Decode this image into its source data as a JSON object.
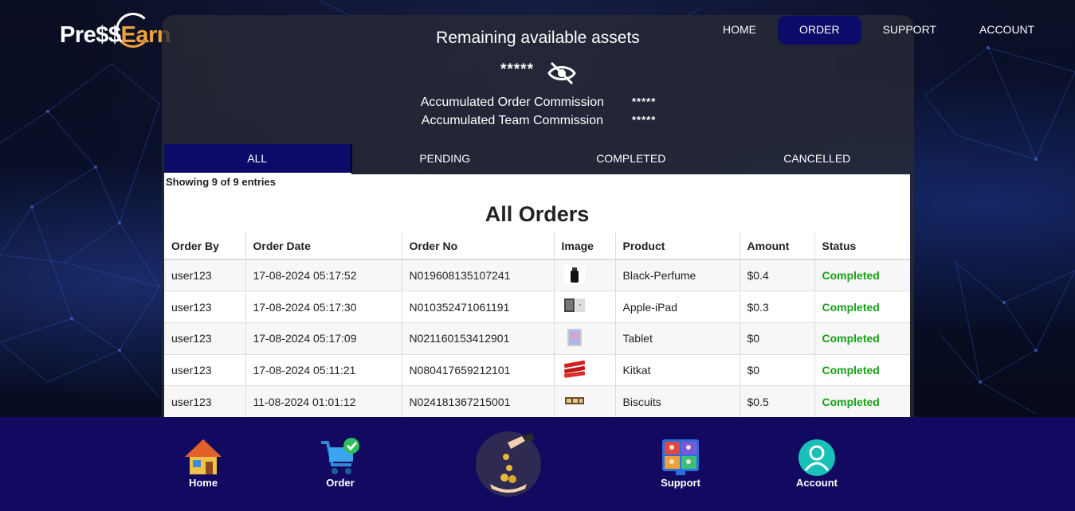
{
  "brand": {
    "logo_part1": "Pre$$",
    "logo_part2": "Earn"
  },
  "nav": {
    "items": [
      {
        "label": "HOME"
      },
      {
        "label": "ORDER"
      },
      {
        "label": "SUPPORT"
      },
      {
        "label": "ACCOUNT"
      }
    ],
    "active": "ORDER"
  },
  "assets": {
    "title": "Remaining available assets",
    "value": "*****",
    "order_commission_label": "Accumulated Order Commission",
    "order_commission_value": "*****",
    "team_commission_label": "Accumulated Team Commission",
    "team_commission_value": "*****"
  },
  "tabs": [
    {
      "label": "ALL"
    },
    {
      "label": "PENDING"
    },
    {
      "label": "COMPLETED"
    },
    {
      "label": "CANCELLED"
    }
  ],
  "orders": {
    "entries_text": "Showing 9 of 9 entries",
    "title": "All Orders",
    "columns": [
      "Order By",
      "Order Date",
      "Order No",
      "Image",
      "Product",
      "Amount",
      "Status"
    ],
    "rows": [
      {
        "by": "user123",
        "date": "17-08-2024 05:17:52",
        "no": "N019608135107241",
        "image": "perfume-thumb",
        "product": "Black-Perfume",
        "amount": "$0.4",
        "status": "Completed"
      },
      {
        "by": "user123",
        "date": "17-08-2024 05:17:30",
        "no": "N010352471061191",
        "image": "ipad-thumb",
        "product": "Apple-iPad",
        "amount": "$0.3",
        "status": "Completed"
      },
      {
        "by": "user123",
        "date": "17-08-2024 05:17:09",
        "no": "N021160153412901",
        "image": "tablet-thumb",
        "product": "Tablet",
        "amount": "$0",
        "status": "Completed"
      },
      {
        "by": "user123",
        "date": "17-08-2024 05:11:21",
        "no": "N080417659212101",
        "image": "kitkat-thumb",
        "product": "Kitkat",
        "amount": "$0",
        "status": "Completed"
      },
      {
        "by": "user123",
        "date": "11-08-2024 01:01:12",
        "no": "N024181367215001",
        "image": "biscuits-thumb",
        "product": "Biscuits",
        "amount": "$0.5",
        "status": "Completed"
      }
    ]
  },
  "bottom_nav": [
    {
      "label": "Home",
      "icon": "house-icon"
    },
    {
      "label": "Order",
      "icon": "cart-icon"
    },
    {
      "label": "",
      "icon": "coins-hand-icon"
    },
    {
      "label": "Support",
      "icon": "support-icon"
    },
    {
      "label": "Account",
      "icon": "user-icon"
    }
  ],
  "colors": {
    "accent": "#0d0b6a",
    "bottom_bar": "#120960",
    "status_completed": "#16a116",
    "logo_orange": "#f0a23a"
  }
}
